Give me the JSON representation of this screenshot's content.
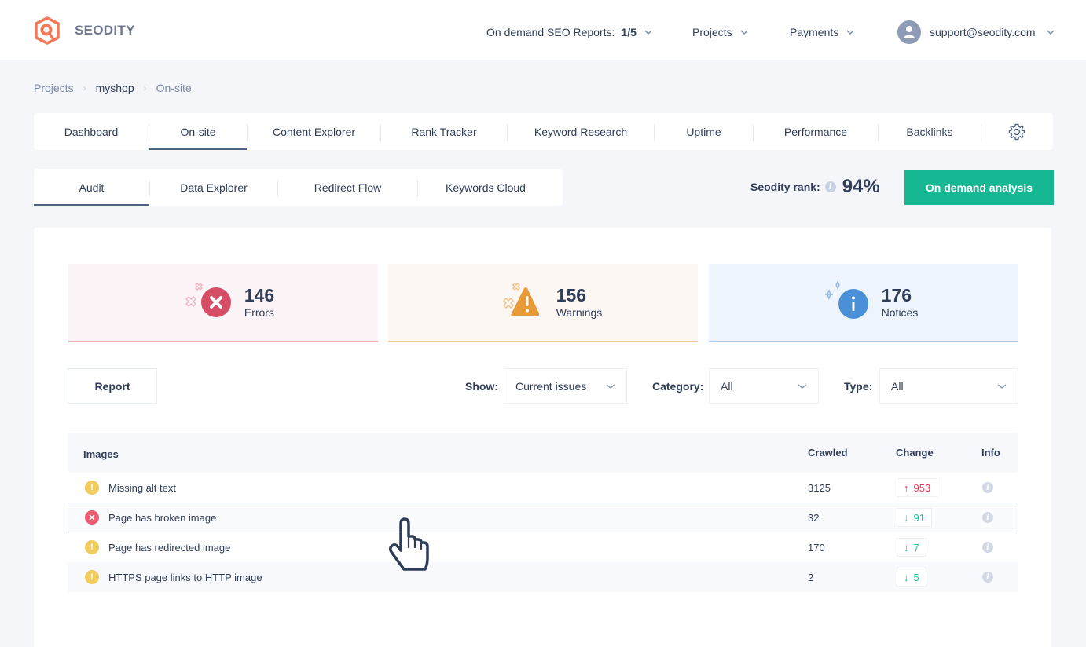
{
  "app": {
    "brand": "SEODITY",
    "logo_color": "#f07a5a"
  },
  "topnav": {
    "reports_label": "On demand SEO Reports:",
    "reports_value": "1/5",
    "projects_label": "Projects",
    "payments_label": "Payments",
    "user_email": "support@seodity.com"
  },
  "breadcrumb": [
    "Projects",
    "myshop",
    "On-site"
  ],
  "main_tabs": [
    {
      "label": "Dashboard",
      "active": false
    },
    {
      "label": "On-site",
      "active": true
    },
    {
      "label": "Content Explorer",
      "active": false
    },
    {
      "label": "Rank Tracker",
      "active": false
    },
    {
      "label": "Keyword Research",
      "active": false
    },
    {
      "label": "Uptime",
      "active": false
    },
    {
      "label": "Performance",
      "active": false
    },
    {
      "label": "Backlinks",
      "active": false
    }
  ],
  "sub_tabs": [
    {
      "label": "Audit",
      "active": true
    },
    {
      "label": "Data Explorer",
      "active": false
    },
    {
      "label": "Redirect Flow",
      "active": false
    },
    {
      "label": "Keywords Cloud",
      "active": false
    }
  ],
  "rank": {
    "label": "Seodity rank:",
    "value": "94%"
  },
  "on_demand_button": "On demand analysis",
  "stats": {
    "errors": {
      "count": "146",
      "label": "Errors",
      "color": "#d64d66"
    },
    "warnings": {
      "count": "156",
      "label": "Warnings",
      "color": "#e89a38"
    },
    "notices": {
      "count": "176",
      "label": "Notices",
      "color": "#4a90d9"
    }
  },
  "filters": {
    "report_button": "Report",
    "show_label": "Show:",
    "show_value": "Current issues",
    "category_label": "Category:",
    "category_value": "All",
    "type_label": "Type:",
    "type_value": "All"
  },
  "table": {
    "headers": {
      "group": "Images",
      "crawled": "Crawled",
      "change": "Change",
      "info": "Info"
    },
    "rows": [
      {
        "severity": "warning",
        "issue": "Missing alt text",
        "crawled": "3125",
        "change_dir": "up",
        "change": "953"
      },
      {
        "severity": "error",
        "issue": "Page has broken image",
        "crawled": "32",
        "change_dir": "down",
        "change": "91"
      },
      {
        "severity": "warning",
        "issue": "Page has redirected image",
        "crawled": "170",
        "change_dir": "down",
        "change": "7"
      },
      {
        "severity": "warning",
        "issue": "HTTPS page links to HTTP image",
        "crawled": "2",
        "change_dir": "down",
        "change": "5"
      }
    ]
  },
  "icons": {
    "warning_glyph": "!",
    "error_glyph": "✕",
    "info_glyph": "i",
    "arrow_up": "↑",
    "arrow_down": "↓"
  }
}
